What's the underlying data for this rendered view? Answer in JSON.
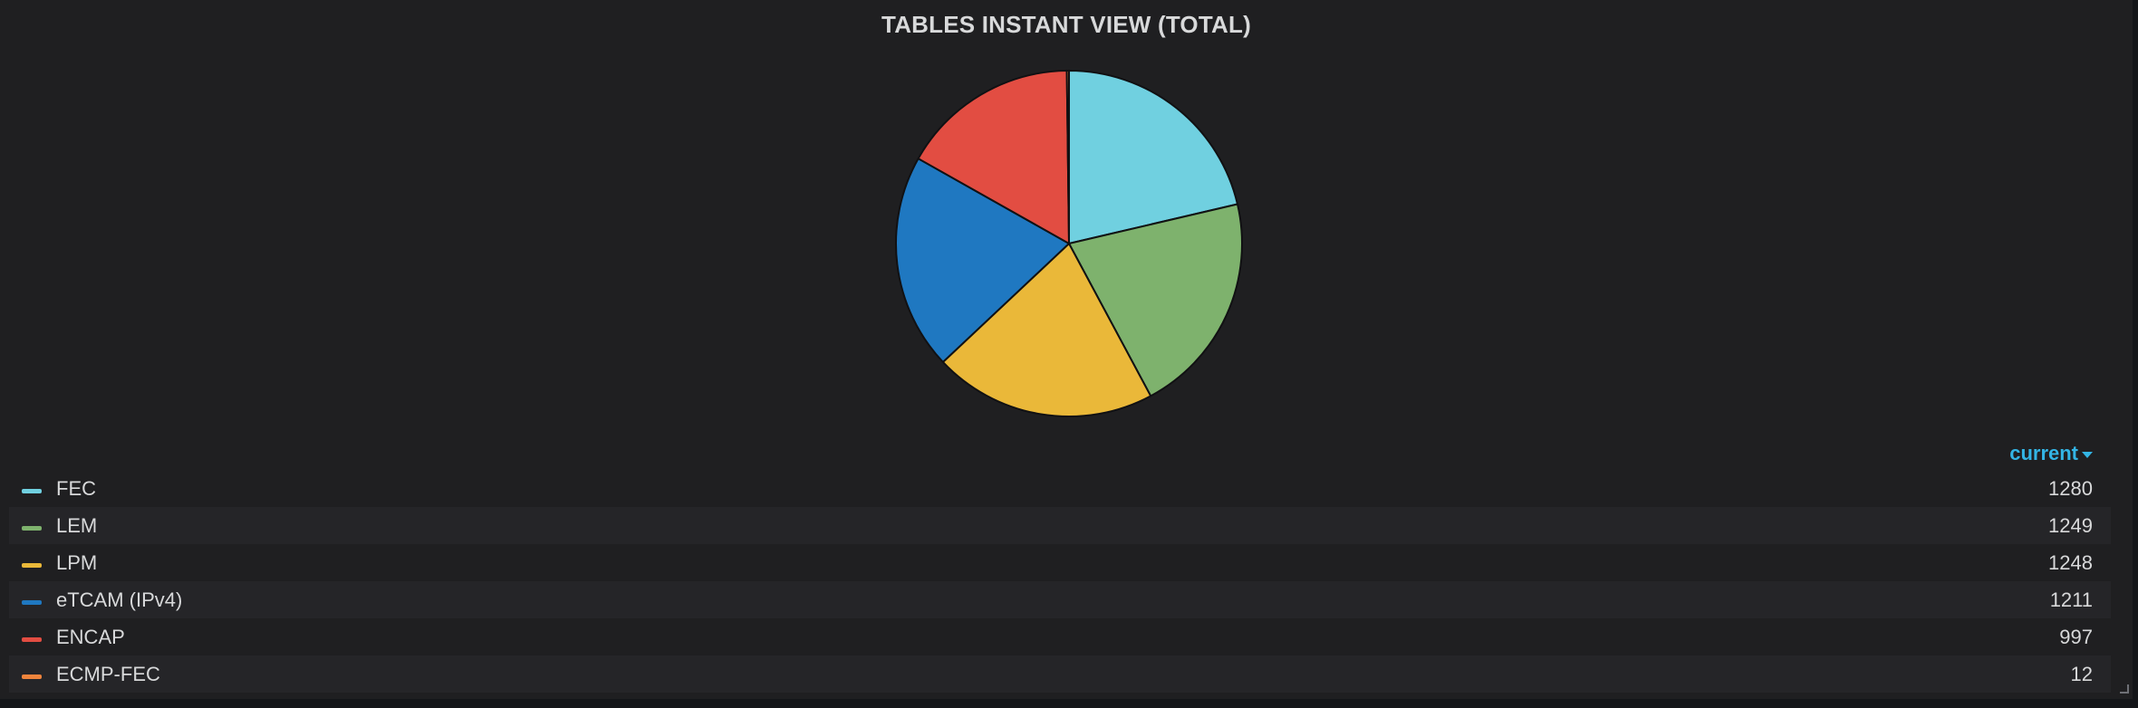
{
  "panel": {
    "title": "TABLES INSTANT VIEW (TOTAL)"
  },
  "legend": {
    "header_label": "current",
    "header_icon": "caret-down-icon"
  },
  "chart_data": {
    "type": "pie",
    "title": "TABLES INSTANT VIEW (TOTAL)",
    "legend_position": "bottom",
    "legend_value_column": "current",
    "series": [
      {
        "name": "FEC",
        "value": 1280,
        "display": "1280",
        "color": "#70d0e0"
      },
      {
        "name": "LEM",
        "value": 1249,
        "display": "1249",
        "color": "#7eb26d"
      },
      {
        "name": "LPM",
        "value": 1248,
        "display": "1248",
        "color": "#eab839"
      },
      {
        "name": "eTCAM (IPv4)",
        "value": 1211,
        "display": "1211",
        "color": "#1f78c1"
      },
      {
        "name": "ENCAP",
        "value": 997,
        "display": "997",
        "color": "#e24d42"
      },
      {
        "name": "ECMP-FEC",
        "value": 12,
        "display": "12",
        "color": "#ef843c"
      }
    ]
  }
}
